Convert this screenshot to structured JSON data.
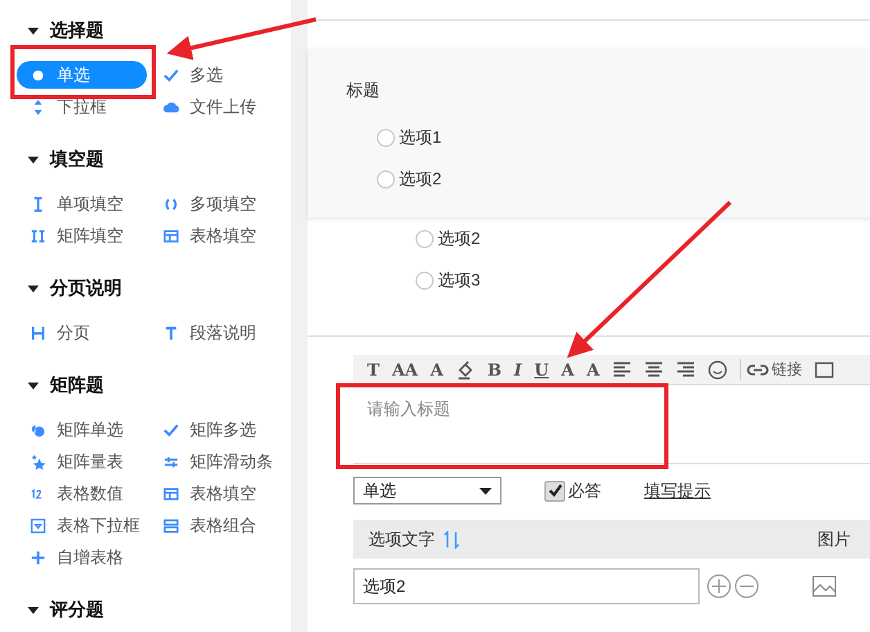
{
  "sidebar": {
    "sections": [
      {
        "title": "选择题",
        "expanded": true,
        "items": [
          {
            "label": "单选",
            "selected": true
          },
          {
            "label": "多选",
            "selected": false
          },
          {
            "label": "下拉框",
            "selected": false
          },
          {
            "label": "文件上传",
            "selected": false
          }
        ]
      },
      {
        "title": "填空题",
        "expanded": true,
        "items": [
          {
            "label": "单项填空",
            "selected": false
          },
          {
            "label": "多项填空",
            "selected": false
          },
          {
            "label": "矩阵填空",
            "selected": false
          },
          {
            "label": "表格填空",
            "selected": false
          }
        ]
      },
      {
        "title": "分页说明",
        "expanded": true,
        "items": [
          {
            "label": "分页",
            "selected": false
          },
          {
            "label": "段落说明",
            "selected": false
          }
        ]
      },
      {
        "title": "矩阵题",
        "expanded": true,
        "items": [
          {
            "label": "矩阵单选",
            "selected": false
          },
          {
            "label": "矩阵多选",
            "selected": false
          },
          {
            "label": "矩阵量表",
            "selected": false
          },
          {
            "label": "矩阵滑动条",
            "selected": false
          },
          {
            "label": "表格数值",
            "selected": false
          },
          {
            "label": "表格填空",
            "selected": false
          },
          {
            "label": "表格下拉框",
            "selected": false
          },
          {
            "label": "表格组合",
            "selected": false
          },
          {
            "label": "自增表格",
            "selected": false
          }
        ]
      },
      {
        "title": "评分题",
        "expanded": true
      }
    ]
  },
  "preview_popup": {
    "title": "标题",
    "options": [
      {
        "label": "选项1",
        "selected": false
      },
      {
        "label": "选项2",
        "selected": false
      }
    ]
  },
  "question_options": [
    {
      "label": "选项2",
      "selected": false
    },
    {
      "label": "选项3",
      "selected": false
    }
  ],
  "editor": {
    "toolbar": [
      {
        "kind": "glyph",
        "glyph": "T"
      },
      {
        "kind": "glyph",
        "glyph": "AA"
      },
      {
        "kind": "glyph",
        "glyph": "A"
      },
      {
        "kind": "fill"
      },
      {
        "kind": "glyph",
        "glyph": "B"
      },
      {
        "kind": "glyph",
        "glyph": "I"
      },
      {
        "kind": "glyph",
        "glyph": "U"
      },
      {
        "kind": "glyph",
        "glyph": "A"
      },
      {
        "kind": "glyph",
        "glyph": "A"
      },
      {
        "kind": "align-left"
      },
      {
        "kind": "align-center"
      },
      {
        "kind": "align-right"
      },
      {
        "kind": "emoji"
      },
      {
        "kind": "link",
        "label": "链接"
      },
      {
        "kind": "image"
      }
    ],
    "title_field": {
      "placeholder": "请输入标题"
    },
    "type_select": "单选",
    "required": {
      "label": "必答",
      "checked": true
    },
    "hint_link": "填写提示",
    "table": {
      "columns": [
        "选项文字",
        "图片"
      ],
      "rows": [
        {
          "value": "选项2"
        }
      ]
    }
  }
}
